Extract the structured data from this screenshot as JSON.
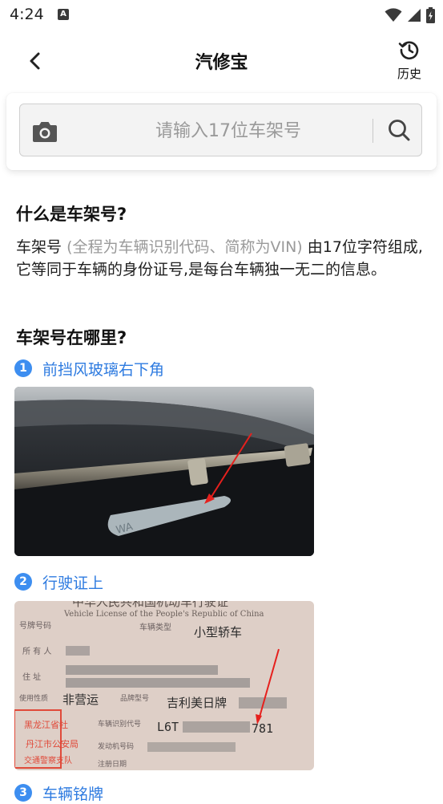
{
  "status_bar": {
    "time": "4:24",
    "notif_icon": "A"
  },
  "header": {
    "title": "汽修宝",
    "history_label": "历史"
  },
  "search": {
    "placeholder": "请输入17位车架号",
    "value": ""
  },
  "what_section": {
    "heading": "什么是车架号?",
    "text_lead": "车架号",
    "text_muted": "(全程为车辆识别代码、简称为VIN)",
    "text_rest": "由17位字符组成,它等同于车辆的身份证号,是每台车辆独一无二的信息。"
  },
  "where_section": {
    "heading": "车架号在哪里?",
    "steps": [
      {
        "num": "1",
        "label": "前挡风玻璃右下角"
      },
      {
        "num": "2",
        "label": "行驶证上"
      },
      {
        "num": "3",
        "label": "车辆铭牌"
      }
    ]
  },
  "license_photo": {
    "title_cn": "中华人民共和国机动车行驶证",
    "title_en": "Vehicle License of the People's Republic of China",
    "vehicle_type": "小型轿车",
    "use_character": "非营运",
    "model": "吉利美日牌",
    "vin_prefix": "L6T",
    "vin_suffix": "781",
    "stamp_line1": "黑龙江省牡",
    "stamp_line2": "丹江市公安局",
    "stamp_line3": "交通警察支队"
  },
  "windshield_photo": {
    "plate_text": "WA"
  },
  "colors": {
    "accent_blue": "#3d8ef0",
    "link_blue": "#2e7be0",
    "muted_gray": "#9a9a9a"
  }
}
